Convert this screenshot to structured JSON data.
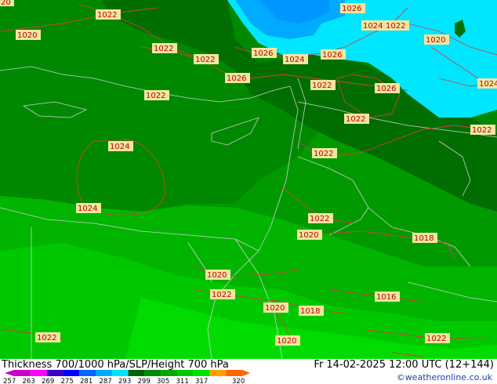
{
  "map": {
    "isobar_labels": [
      "20",
      "1022",
      "1020",
      "1022",
      "1022",
      "1026",
      "1026",
      "1024",
      "1026",
      "1026",
      "1024",
      "1022",
      "1020",
      "1022",
      "1026",
      "1022",
      "1024",
      "1024",
      "1024",
      "1022",
      "1022",
      "1022",
      "1022",
      "1020",
      "1018",
      "1020",
      "1022",
      "1016",
      "1020",
      "1018",
      "1022",
      "1020",
      "1022"
    ]
  },
  "footer": {
    "title": "Thickness 700/1000 hPa/SLP/Height 700 hPa",
    "datetime": "Fr 14-02-2025 12:00 UTC (12+144)",
    "copyright": "©weatheronline.co.uk",
    "scale_ticks": [
      "257",
      "263",
      "269",
      "275",
      "281",
      "287",
      "293",
      "299",
      "305",
      "311",
      "317",
      "320"
    ]
  },
  "colors": {
    "scale": [
      "#c800c8",
      "#ff00ff",
      "#3a00c8",
      "#0000ff",
      "#0064ff",
      "#00aaff",
      "#00e1ff",
      "#006400",
      "#008c00",
      "#00aa00",
      "#00c800",
      "#00e100",
      "#ffa000",
      "#ff6400"
    ],
    "isobar": "#d04040",
    "border": "#c8c8c8"
  }
}
